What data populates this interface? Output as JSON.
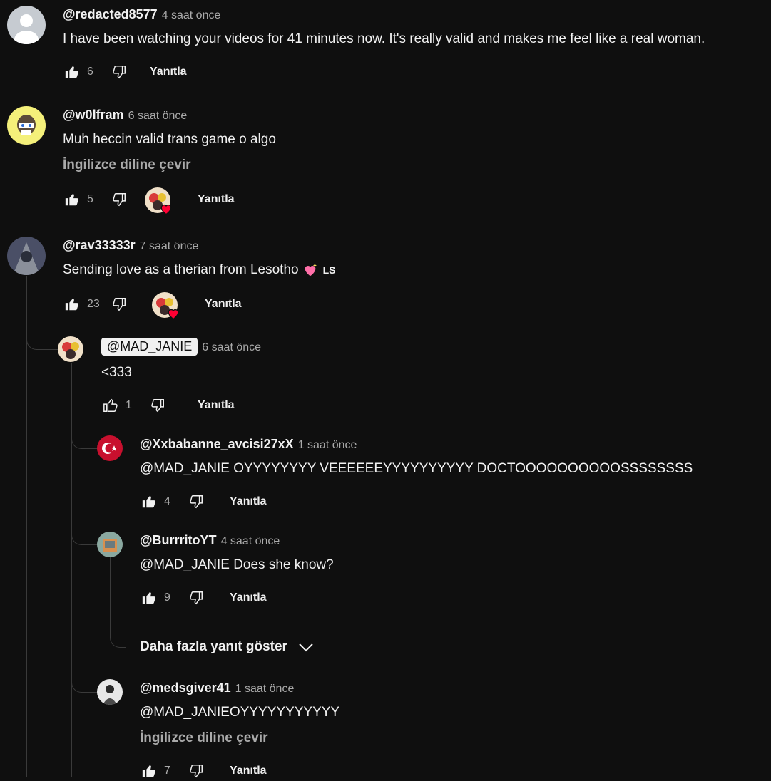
{
  "reply_label": "Yanıtla",
  "translate_label": "İngilizce diline çevir",
  "more_replies_label": "Daha fazla yanıt göster",
  "comments": [
    {
      "handle": "@redacted8577",
      "time": "4 saat önce",
      "text": "I have been watching your videos for 41 minutes now. It's really valid and makes me feel like a real woman.",
      "likes": "6"
    },
    {
      "handle": "@w0lfram",
      "time": "6 saat önce",
      "text": "Muh heccin valid trans game o algo",
      "likes": "5"
    },
    {
      "handle": "@rav33333r",
      "time": "7 saat önce",
      "text": "Sending love as a therian from Lesotho",
      "text_suffix": "LS",
      "likes": "23"
    }
  ],
  "replies": [
    {
      "handle": "@MAD_JANIE",
      "time": "6 saat önce",
      "text": "<333",
      "likes": "1"
    },
    {
      "handle": "@Xxbabanne_avcisi27xX",
      "time": "1 saat önce",
      "text": "@MAD_JANIE OYYYYYYYY VEEEEEEYYYYYYYYYY DOCTOOOOOOOOOOSSSSSSSS",
      "likes": "4"
    },
    {
      "handle": "@BurrritoYT",
      "time": "4 saat önce",
      "text": "@MAD_JANIE Does she know?",
      "likes": "9"
    },
    {
      "handle": "@medsgiver41",
      "time": "1 saat önce",
      "text": "@MAD_JANIEOYYYYYYYYYYY",
      "likes": "7"
    }
  ],
  "colors": {
    "background": "#0f0f0f",
    "text": "#f1f1f1",
    "muted": "#aaaaaa",
    "heart": "#ff0033"
  },
  "icons": [
    "thumb-up-icon",
    "thumb-down-icon",
    "heart-icon",
    "chevron-down-icon"
  ]
}
